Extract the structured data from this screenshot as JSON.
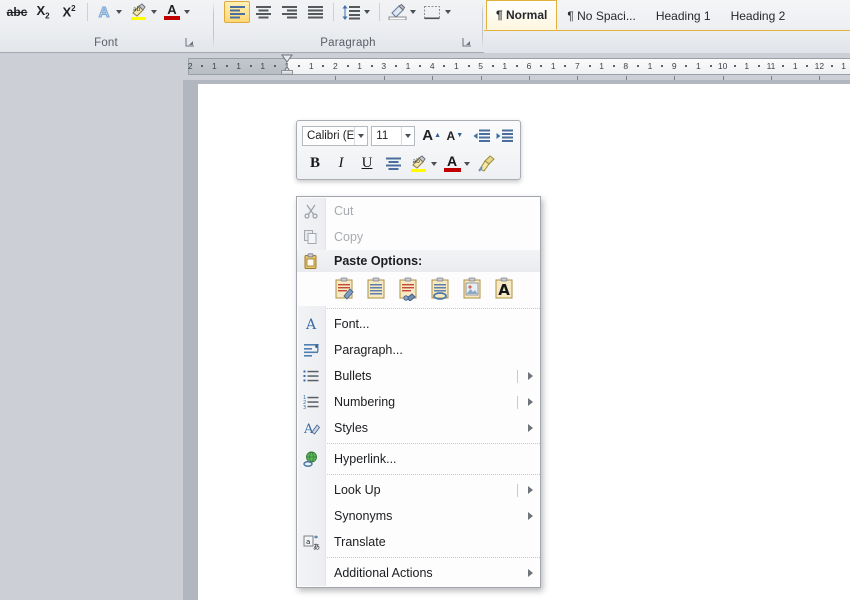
{
  "ribbon": {
    "groups": [
      {
        "label": "Font",
        "buttons": [
          {
            "name": "strikethrough-button",
            "glyph": "abc"
          },
          {
            "name": "subscript-button",
            "glyph": "X2"
          },
          {
            "name": "superscript-button",
            "glyph": "X2sup"
          },
          {
            "name": "text-effects-button",
            "glyph": "A-outline"
          },
          {
            "name": "text-highlight-color-button",
            "glyph": "highlighter"
          },
          {
            "name": "font-color-button",
            "glyph": "A-red"
          }
        ],
        "launcher": "font-dialog-launcher"
      },
      {
        "label": "Paragraph",
        "buttons": [
          {
            "name": "align-left-button",
            "glyph": "align-left",
            "selected": true
          },
          {
            "name": "align-center-button",
            "glyph": "align-center",
            "selected": false
          },
          {
            "name": "align-right-button",
            "glyph": "align-right",
            "selected": false
          },
          {
            "name": "justify-button",
            "glyph": "justify",
            "selected": false
          },
          {
            "name": "line-spacing-button",
            "glyph": "line-spacing",
            "selected": false
          },
          {
            "name": "shading-button",
            "glyph": "shading",
            "selected": false
          },
          {
            "name": "borders-button",
            "glyph": "borders",
            "selected": false
          }
        ],
        "launcher": "paragraph-dialog-launcher"
      }
    ],
    "styles_gallery": [
      {
        "label": "¶ Normal",
        "selected": true
      },
      {
        "label": "¶ No Spaci...",
        "selected": false
      },
      {
        "label": "Heading 1",
        "selected": false
      },
      {
        "label": "Heading 2",
        "selected": false
      }
    ]
  },
  "ruler": {
    "left_labels": [
      "2",
      "1",
      "1"
    ],
    "right_labels": [
      "1",
      "1",
      "2",
      "1",
      "3",
      "1",
      "4",
      "1",
      "5",
      "1",
      "6",
      "1",
      "7",
      "1",
      "8",
      "1",
      "9",
      "1",
      "10",
      "1",
      "11",
      "1",
      "12",
      "1"
    ],
    "unit_marks": [
      "2",
      "·",
      "1",
      "·",
      "1",
      "·",
      "1",
      "·",
      "1",
      "·",
      "1",
      "·",
      "2",
      "·",
      "1",
      "·",
      "3",
      "·",
      "1",
      "·",
      "4",
      "·",
      "1",
      "·",
      "5",
      "·",
      "1",
      "·",
      "6",
      "·",
      "1",
      "·",
      "7",
      "·",
      "1",
      "·",
      "8",
      "·",
      "1",
      "·",
      "9",
      "·",
      "1",
      "·",
      "10",
      "·",
      "1",
      "·",
      "11",
      "·",
      "1",
      "·",
      "12",
      "·",
      "1",
      "·"
    ]
  },
  "mini_toolbar": {
    "font_name": "Calibri (E",
    "font_size": "11",
    "row1": [
      {
        "name": "grow-font-button",
        "glyph": "A-up"
      },
      {
        "name": "shrink-font-button",
        "glyph": "A-down"
      },
      {
        "name": "decrease-indent-button",
        "glyph": "indent-left"
      },
      {
        "name": "increase-indent-button",
        "glyph": "indent-right"
      }
    ],
    "row2": [
      {
        "name": "bold-button",
        "glyph": "B"
      },
      {
        "name": "italic-button",
        "glyph": "I"
      },
      {
        "name": "underline-button",
        "glyph": "U"
      },
      {
        "name": "center-button",
        "glyph": "align-center"
      },
      {
        "name": "text-highlight-color-button",
        "glyph": "highlighter"
      },
      {
        "name": "font-color-button",
        "glyph": "A-red"
      },
      {
        "name": "format-painter-button",
        "glyph": "paintbrush"
      }
    ]
  },
  "context_menu": {
    "items": [
      {
        "id": "cut",
        "label": "Cut",
        "accel": "t",
        "icon": "scissors-icon",
        "disabled": true,
        "submenu": false,
        "separator_before_arrow": false
      },
      {
        "id": "copy",
        "label": "Copy",
        "accel": "C",
        "icon": "copy-icon",
        "disabled": true,
        "submenu": false,
        "separator_before_arrow": false
      }
    ],
    "paste_header": "Paste Options:",
    "paste_icon": "paste-clipboard-icon",
    "paste_options": [
      {
        "id": "keep-source-formatting",
        "name": "paste-keep-source-formatting-button"
      },
      {
        "id": "merge-formatting",
        "name": "paste-merge-formatting-button"
      },
      {
        "id": "paste-special",
        "name": "paste-special-button"
      },
      {
        "id": "keep-text-only",
        "name": "paste-link-button"
      },
      {
        "id": "paste-as-picture",
        "name": "paste-as-picture-button"
      },
      {
        "id": "text-only",
        "name": "paste-text-only-button"
      }
    ],
    "group2": [
      {
        "id": "font",
        "label": "Font...",
        "accel": "F",
        "icon": "font-a-icon",
        "submenu": false,
        "arrow_sep": false
      },
      {
        "id": "paragraph",
        "label": "Paragraph...",
        "accel": "P",
        "icon": "paragraph-icon",
        "submenu": false,
        "arrow_sep": false
      },
      {
        "id": "bullets",
        "label": "Bullets",
        "accel": "B",
        "icon": "bullet-list-icon",
        "submenu": true,
        "arrow_sep": true
      },
      {
        "id": "numbering",
        "label": "Numbering",
        "accel": "N",
        "icon": "numbered-list-icon",
        "submenu": true,
        "arrow_sep": true
      },
      {
        "id": "styles",
        "label": "Styles",
        "accel": "y",
        "icon": "styles-icon",
        "submenu": true,
        "arrow_sep": false
      }
    ],
    "group3": [
      {
        "id": "hyperlink",
        "label": "Hyperlink...",
        "accel": "H",
        "icon": "hyperlink-globe-icon",
        "submenu": false,
        "arrow_sep": false
      }
    ],
    "group4": [
      {
        "id": "lookup",
        "label": "Look Up",
        "accel": "k",
        "icon": "",
        "submenu": true,
        "arrow_sep": true
      },
      {
        "id": "synonyms",
        "label": "Synonyms",
        "accel": "y",
        "icon": "",
        "submenu": true,
        "arrow_sep": false
      },
      {
        "id": "translate",
        "label": "Translate",
        "accel": "s",
        "icon": "translate-icon",
        "submenu": false,
        "arrow_sep": false
      }
    ],
    "group5": [
      {
        "id": "additional-actions",
        "label": "Additional Actions",
        "accel": "A",
        "icon": "",
        "submenu": true,
        "arrow_sep": false
      }
    ]
  },
  "colors": {
    "ribbon_bg": "#eceef1",
    "workspace_bg": "#ccd0d6",
    "page_bg": "#ffffff",
    "menu_bg": "#fdfdfd",
    "menu_border": "#a2a7ae",
    "accent_gold": "#e3b23c",
    "highlight_yellow": "#ffff00",
    "font_color_red": "#c00000",
    "disabled_text": "#a7abb1"
  }
}
